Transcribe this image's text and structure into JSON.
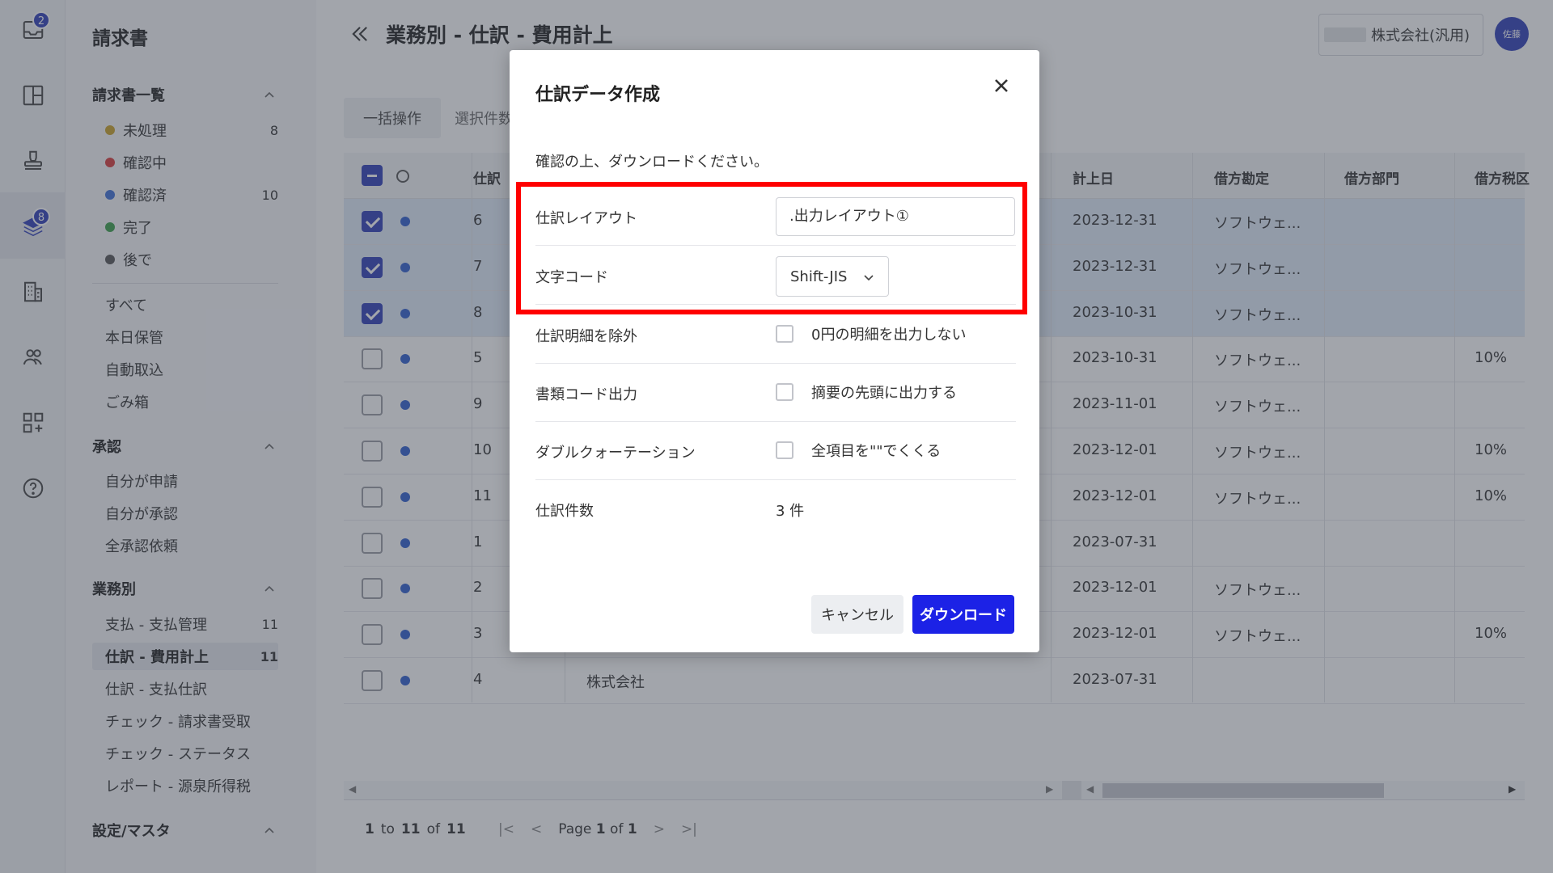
{
  "rail": {
    "icons": [
      {
        "name": "inbox-icon",
        "badge": "2"
      },
      {
        "name": "layout-grid-icon",
        "badge": ""
      },
      {
        "name": "stamp-icon",
        "badge": ""
      },
      {
        "name": "layers-icon",
        "badge": "8"
      },
      {
        "name": "building-icon",
        "badge": ""
      },
      {
        "name": "users-icon",
        "badge": ""
      },
      {
        "name": "apps-add-icon",
        "badge": ""
      },
      {
        "name": "help-circle-icon",
        "badge": ""
      }
    ]
  },
  "sidebar": {
    "title": "請求書",
    "section_list": "請求書一覧",
    "status_items": [
      {
        "label": "未処理",
        "count": "8",
        "color": "#c9a227"
      },
      {
        "label": "確認中",
        "count": "",
        "color": "#d93a3a"
      },
      {
        "label": "確認済",
        "count": "10",
        "color": "#3f6fd6"
      },
      {
        "label": "完了",
        "count": "",
        "color": "#3aa04a"
      },
      {
        "label": "後で",
        "count": "",
        "color": "#555555"
      }
    ],
    "misc_items": [
      "すべて",
      "本日保管",
      "自動取込",
      "ごみ箱"
    ],
    "section_approval": "承認",
    "approval_items": [
      "自分が申請",
      "自分が承認",
      "全承認依頼"
    ],
    "section_business": "業務別",
    "business_items": [
      {
        "label": "支払 - 支払管理",
        "count": "11"
      },
      {
        "label": "仕訳 - 費用計上",
        "count": "11"
      },
      {
        "label": "仕訳 - 支払仕訳",
        "count": ""
      },
      {
        "label": "チェック - 請求書受取",
        "count": ""
      },
      {
        "label": "チェック - ステータス",
        "count": ""
      },
      {
        "label": "レポート - 源泉所得税",
        "count": ""
      }
    ],
    "section_settings": "設定/マスタ"
  },
  "header": {
    "title": "業務別 - 仕訳 - 費用計上",
    "company": "株式会社(汎用)",
    "avatar": "佐藤"
  },
  "toolbar": {
    "bulk_label": "一括操作",
    "selected_label": "選択件数"
  },
  "grid": {
    "headers": {
      "no": "仕訳",
      "date": "計上日",
      "account": "借方勘定",
      "dept": "借方部門",
      "tax": "借方税区"
    },
    "rows": [
      {
        "no": "6",
        "date": "2023-12-31",
        "account": "ソフトウェ...",
        "tax": "",
        "company": "",
        "selected": true
      },
      {
        "no": "7",
        "date": "2023-12-31",
        "account": "ソフトウェ...",
        "tax": "",
        "company": "",
        "selected": true
      },
      {
        "no": "8",
        "date": "2023-10-31",
        "account": "ソフトウェ...",
        "tax": "",
        "company": "",
        "selected": true
      },
      {
        "no": "5",
        "date": "2023-10-31",
        "account": "ソフトウェ...",
        "tax": "10%",
        "company": "",
        "selected": false
      },
      {
        "no": "9",
        "date": "2023-11-01",
        "account": "ソフトウェ...",
        "tax": "",
        "company": "",
        "selected": false
      },
      {
        "no": "10",
        "date": "2023-12-01",
        "account": "ソフトウェ...",
        "tax": "10%",
        "company": "",
        "selected": false
      },
      {
        "no": "11",
        "date": "2023-12-01",
        "account": "ソフトウェ...",
        "tax": "10%",
        "company": "",
        "selected": false
      },
      {
        "no": "1",
        "date": "2023-07-31",
        "account": "",
        "tax": "",
        "company": "",
        "selected": false
      },
      {
        "no": "2",
        "date": "2023-12-01",
        "account": "ソフトウェ...",
        "tax": "",
        "company": "",
        "selected": false
      },
      {
        "no": "3",
        "date": "2023-12-01",
        "account": "ソフトウェ...",
        "tax": "10%",
        "company": "",
        "selected": false
      },
      {
        "no": "4",
        "date": "2023-07-31",
        "account": "",
        "tax": "",
        "company": "株式会社",
        "selected": false
      }
    ]
  },
  "pager": {
    "from": "1",
    "to_label": "to",
    "to": "11",
    "of_label": "of",
    "total": "11",
    "page_label": "Page",
    "page": "1",
    "page_of": "of",
    "pages": "1"
  },
  "modal": {
    "title": "仕訳データ作成",
    "subtitle": "確認の上、ダウンロードください。",
    "layout_label": "仕訳レイアウト",
    "layout_value": ".出力レイアウト①",
    "encoding_label": "文字コード",
    "encoding_value": "Shift-JIS",
    "exclude_label": "仕訳明細を除外",
    "exclude_option": "0円の明細を出力しない",
    "doccode_label": "書類コード出力",
    "doccode_option": "摘要の先頭に出力する",
    "quote_label": "ダブルクォーテーション",
    "quote_option": "全項目を\"\"でくくる",
    "count_label": "仕訳件数",
    "count_value": "3 件",
    "cancel_label": "キャンセル",
    "download_label": "ダウンロード"
  },
  "colors": {
    "accent": "#2f3fb8",
    "download": "#1c22e6",
    "highlight": "#ff0000"
  }
}
